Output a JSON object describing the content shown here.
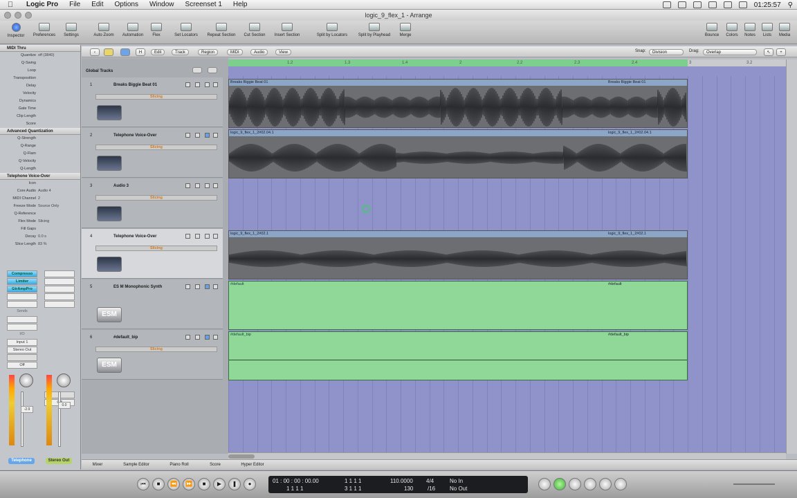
{
  "menubar": {
    "app": "Logic Pro",
    "items": [
      "File",
      "Edit",
      "Options",
      "Window",
      "Screenset 1",
      "Help"
    ],
    "time": "01:25:57"
  },
  "window": {
    "title": "logic_9_flex_1 - Arrange"
  },
  "toolbar": {
    "left": [
      "Inspector",
      "Preferences",
      "Settings"
    ],
    "mid": [
      "Auto Zoom",
      "Automation",
      "Flex"
    ],
    "sections": [
      "Set Locators",
      "Repeat Section",
      "Cut Section",
      "Insert Section"
    ],
    "split": [
      "Split by Locators",
      "Split by Playhead",
      "Merge"
    ],
    "right": [
      "Bounce",
      "Colors",
      "Notes",
      "Lists",
      "Media"
    ]
  },
  "inspector": {
    "header1": "MIDI Thru",
    "params1": [
      {
        "k": "Quantize",
        "v": "off (3840)"
      },
      {
        "k": "Q-Swing",
        "v": ""
      },
      {
        "k": "Loop",
        "v": ""
      },
      {
        "k": "Transposition",
        "v": ""
      },
      {
        "k": "Delay",
        "v": ""
      },
      {
        "k": "Velocity",
        "v": ""
      },
      {
        "k": "Dynamics",
        "v": ""
      },
      {
        "k": "Gate Time",
        "v": ""
      },
      {
        "k": "Clip Length",
        "v": ""
      },
      {
        "k": "Score",
        "v": ""
      }
    ],
    "header2": "Advanced Quantization",
    "params2": [
      {
        "k": "Q-Strength",
        "v": ""
      },
      {
        "k": "Q-Range",
        "v": ""
      },
      {
        "k": "Q-Flam",
        "v": ""
      },
      {
        "k": "Q-Velocity",
        "v": ""
      },
      {
        "k": "Q-Length",
        "v": ""
      }
    ],
    "header3": "Telephone Voice-Over",
    "params3": [
      {
        "k": "Icon",
        "v": ""
      },
      {
        "k": "Core Audio",
        "v": "Audio 4"
      },
      {
        "k": "MIDI Channel",
        "v": "2"
      },
      {
        "k": "Freeze Mode",
        "v": "Source Only"
      },
      {
        "k": "Q-Reference",
        "v": ""
      },
      {
        "k": "Flex Mode",
        "v": "Slicing"
      },
      {
        "k": "Fill Gaps",
        "v": ""
      },
      {
        "k": "Decay",
        "v": "0.0 s"
      },
      {
        "k": "Slice Length",
        "v": "83 %"
      }
    ],
    "strip1": {
      "plugins": [
        "Compresso",
        "Limiter",
        "GtrAmpPro"
      ],
      "sends": "Sends",
      "io": "I/O",
      "input": "Input 1",
      "output": "Stereo Out",
      "auto": "Off",
      "name": "Telephone",
      "vol": "-2.9"
    },
    "strip2": {
      "auto": "Off",
      "name": "Stereo Out",
      "vol": "0.0"
    }
  },
  "arrange": {
    "menus": [
      "Edit",
      "Track",
      "Region",
      "MIDI",
      "Audio",
      "View"
    ],
    "snap_label": "Snap:",
    "snap": "Division",
    "drag_label": "Drag:",
    "drag": "Overlap",
    "global": "Global Tracks"
  },
  "ruler": {
    "ticks": [
      "1.2",
      "1.3",
      "1.4",
      "2",
      "2.2",
      "2.3",
      "2.4",
      "3",
      "3.2"
    ]
  },
  "tracks": [
    {
      "num": "1",
      "name": "Breaks Biggie Beat 01",
      "mode": "Slicing"
    },
    {
      "num": "2",
      "name": "Telephone Voice-Over",
      "mode": "Slicing"
    },
    {
      "num": "3",
      "name": "Audio 3",
      "mode": "Slicing"
    },
    {
      "num": "4",
      "name": "Telephone Voice-Over",
      "mode": "Slicing"
    },
    {
      "num": "5",
      "name": "ES M Monophonic Synth",
      "mode": "",
      "icon": "ESM"
    },
    {
      "num": "6",
      "name": "#default_bip",
      "mode": "Slicing",
      "icon": "ESM"
    }
  ],
  "regions": [
    {
      "name": "Breaks Biggie Beat 01",
      "name2": "Breaks Biggie Beat 01"
    },
    {
      "name": "logic_9_flex_1_2#02.04.1",
      "name2": "logic_9_flex_1_2#02.04.1"
    },
    {
      "name": "logic_9_flex_1_2#02.1",
      "name2": "logic_9_flex_1_2#02.1"
    },
    {
      "name": "#default",
      "name2": "#default"
    },
    {
      "name": "#default_bip",
      "name2": "#default_bip"
    }
  ],
  "tabs": [
    "Mixer",
    "Sample Editor",
    "Piano Roll",
    "Score",
    "Hyper Editor"
  ],
  "lcd": {
    "smpte": "01 : 00 : 00 : 00.00",
    "bars": "1  1  1  1",
    "bars2": "1  1  1  1",
    "pos": "1  1  1  1",
    "pos2": "3  1  1  1",
    "tempo": "110.0000",
    "tempo2": "130",
    "sig": "4/4",
    "sig2": "/16",
    "in": "No In",
    "out": "No Out"
  }
}
